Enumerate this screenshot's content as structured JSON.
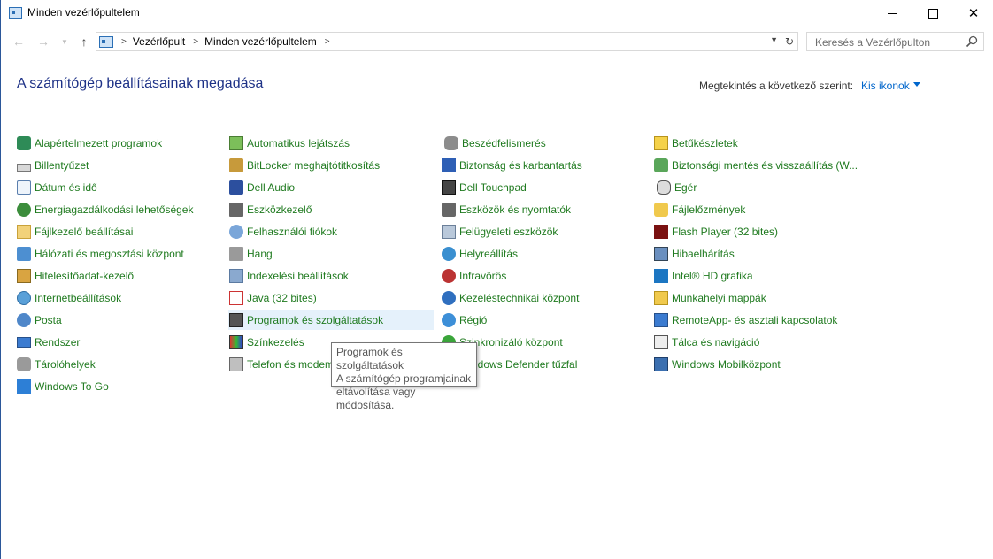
{
  "window": {
    "title": "Minden vezérlőpultelem"
  },
  "address": {
    "breadcrumbs": [
      "Vezérlőpult",
      "Minden vezérlőpultelem"
    ],
    "search_placeholder": "Keresés a Vezérlőpulton"
  },
  "header": {
    "title": "A számítógép beállításainak megadása",
    "view_by_label": "Megtekintés a következő szerint:",
    "view_by_value": "Kis ikonok"
  },
  "columns": [
    [
      {
        "label": "Alapértelmezett programok",
        "icon": "default-programs-icon"
      },
      {
        "label": "Billentyűzet",
        "icon": "keyboard-icon"
      },
      {
        "label": "Dátum és idő",
        "icon": "clock-icon"
      },
      {
        "label": "Energiagazdálkodási lehetőségek",
        "icon": "power-options-icon"
      },
      {
        "label": "Fájlkezelő beállításai",
        "icon": "folder-options-icon"
      },
      {
        "label": "Hálózati és megosztási központ",
        "icon": "network-icon"
      },
      {
        "label": "Hitelesítőadat-kezelő",
        "icon": "credential-vault-icon"
      },
      {
        "label": "Internetbeállítások",
        "icon": "internet-options-icon"
      },
      {
        "label": "Posta",
        "icon": "mail-icon"
      },
      {
        "label": "Rendszer",
        "icon": "system-monitor-icon"
      },
      {
        "label": "Tárolóhelyek",
        "icon": "storage-spaces-icon"
      },
      {
        "label": "Windows To Go",
        "icon": "windows-to-go-icon"
      }
    ],
    [
      {
        "label": "Automatikus lejátszás",
        "icon": "autoplay-icon"
      },
      {
        "label": "BitLocker meghajtótitkosítás",
        "icon": "bitlocker-icon"
      },
      {
        "label": "Dell Audio",
        "icon": "dell-audio-icon"
      },
      {
        "label": "Eszközkezelő",
        "icon": "device-manager-icon"
      },
      {
        "label": "Felhasználói fiókok",
        "icon": "user-accounts-icon"
      },
      {
        "label": "Hang",
        "icon": "speaker-icon"
      },
      {
        "label": "Indexelési beállítások",
        "icon": "indexing-icon"
      },
      {
        "label": "Java (32 bites)",
        "icon": "java-icon"
      },
      {
        "label": "Programok és szolgáltatások",
        "icon": "programs-features-icon"
      },
      {
        "label": "Színkezelés",
        "icon": "color-management-icon"
      },
      {
        "label": "Telefon és modem",
        "icon": "phone-modem-icon"
      }
    ],
    [
      {
        "label": "Beszédfelismerés",
        "icon": "microphone-icon"
      },
      {
        "label": "Biztonság és karbantartás",
        "icon": "flag-icon"
      },
      {
        "label": "Dell Touchpad",
        "icon": "touchpad-icon"
      },
      {
        "label": "Eszközök és nyomtatók",
        "icon": "printer-icon"
      },
      {
        "label": "Felügyeleti eszközök",
        "icon": "admin-tools-icon"
      },
      {
        "label": "Helyreállítás",
        "icon": "recovery-icon"
      },
      {
        "label": "Infravörös",
        "icon": "infrared-icon"
      },
      {
        "label": "Kezeléstechnikai központ",
        "icon": "ease-of-access-icon"
      },
      {
        "label": "Régió",
        "icon": "globe-icon"
      },
      {
        "label": "Szinkronizáló központ",
        "icon": "sync-icon"
      },
      {
        "label": "Windows Defender tűzfal",
        "icon": "firewall-icon"
      }
    ],
    [
      {
        "label": "Betűkészletek",
        "icon": "fonts-icon"
      },
      {
        "label": "Biztonsági mentés és visszaállítás (W...",
        "icon": "backup-icon"
      },
      {
        "label": "Egér",
        "icon": "mouse-icon"
      },
      {
        "label": "Fájlelőzmények",
        "icon": "file-history-icon"
      },
      {
        "label": "Flash Player (32 bites)",
        "icon": "flash-player-icon"
      },
      {
        "label": "Hibaelhárítás",
        "icon": "troubleshooting-icon"
      },
      {
        "label": "Intel® HD grafika",
        "icon": "intel-graphics-icon"
      },
      {
        "label": "Munkahelyi mappák",
        "icon": "work-folders-icon"
      },
      {
        "label": "RemoteApp- és asztali kapcsolatok",
        "icon": "remote-desktop-icon"
      },
      {
        "label": "Tálca és navigáció",
        "icon": "taskbar-icon"
      },
      {
        "label": "Windows Mobilközpont",
        "icon": "mobility-center-icon"
      }
    ]
  ],
  "tooltip": {
    "line1": "Programok és szolgáltatások",
    "line2": "A számítógép programjainak",
    "line3": "eltávolítása vagy módosítása."
  }
}
